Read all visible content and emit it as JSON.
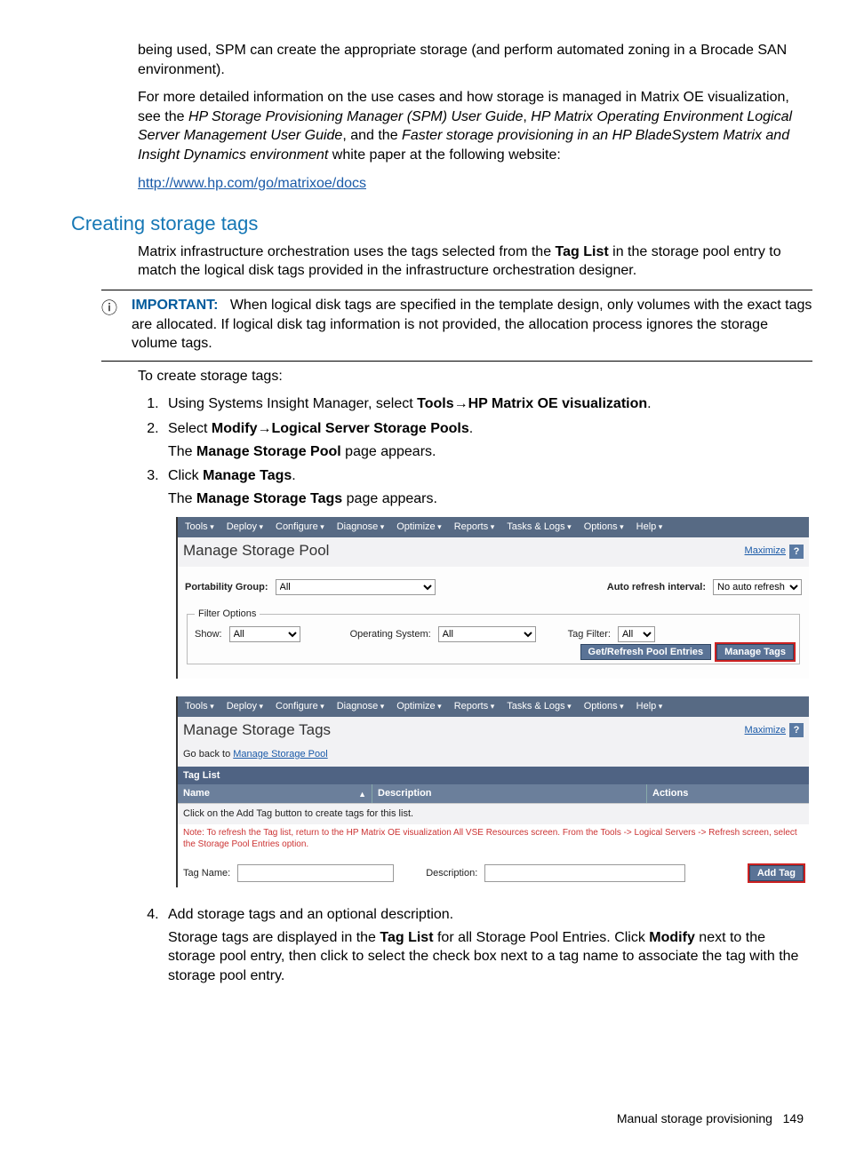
{
  "para1": "being used, SPM can create the appropriate storage (and perform automated zoning in a Brocade SAN environment).",
  "para2a": "For more detailed information on the use cases and how storage is managed in Matrix OE visualization, see the ",
  "para2_em1": "HP Storage Provisioning Manager (SPM) User Guide",
  "para2b": ", ",
  "para2_em2": "HP Matrix Operating Environment Logical Server Management User Guide",
  "para2c": ", and the ",
  "para2_em3": "Faster storage provisioning in an HP BladeSystem Matrix and Insight Dynamics environment",
  "para2d": " white paper at the following website:",
  "doc_link": "http://www.hp.com/go/matrixoe/docs",
  "heading": "Creating storage tags",
  "intro_a": "Matrix infrastructure orchestration uses the tags selected from the ",
  "intro_bold": "Tag List",
  "intro_b": " in the storage pool entry to match the logical disk tags provided in the infrastructure orchestration designer.",
  "important_label": "IMPORTANT:",
  "important_text": "When logical disk tags are specified in the template design, only volumes with the exact tags are allocated. If logical disk tag information is not provided, the allocation process ignores the storage volume tags.",
  "steps_intro": "To create storage tags:",
  "step1_a": "Using Systems Insight Manager, select ",
  "step1_b1": "Tools",
  "step1_arrow": "→",
  "step1_b2": "HP Matrix OE visualization",
  "step1_end": ".",
  "step2_a": "Select ",
  "step2_b1": "Modify",
  "step2_b2": "Logical Server Storage Pools",
  "step2_end": ".",
  "step2_sub_a": "The ",
  "step2_sub_b": "Manage Storage Pool",
  "step2_sub_c": " page appears.",
  "step3_a": "Click ",
  "step3_b": "Manage Tags",
  "step3_end": ".",
  "step3_sub_a": "The ",
  "step3_sub_b": "Manage Storage Tags",
  "step3_sub_c": " page appears.",
  "menubar": [
    "Tools",
    "Deploy",
    "Configure",
    "Diagnose",
    "Optimize",
    "Reports",
    "Tasks & Logs",
    "Options",
    "Help"
  ],
  "shot1": {
    "title": "Manage Storage Pool",
    "maximize": "Maximize",
    "help": "?",
    "portability_label": "Portability Group:",
    "portability_value": "All",
    "auto_refresh_label": "Auto refresh interval:",
    "auto_refresh_value": "No auto refresh",
    "filter_legend": "Filter Options",
    "show_label": "Show:",
    "show_value": "All",
    "os_label": "Operating System:",
    "os_value": "All",
    "tagfilter_label": "Tag Filter:",
    "tagfilter_value": "All",
    "btn_refresh": "Get/Refresh Pool Entries",
    "btn_manage": "Manage Tags"
  },
  "shot2": {
    "title": "Manage Storage Tags",
    "maximize": "Maximize",
    "help": "?",
    "goback_a": "Go back to ",
    "goback_link": "Manage Storage Pool",
    "taglist_header": "Tag List",
    "col_name": "Name",
    "col_desc": "Description",
    "col_actions": "Actions",
    "hint": "Click on the Add Tag button to create tags for this list.",
    "note": "Note: To refresh the Tag list, return to the HP Matrix OE visualization All VSE Resources screen. From the Tools -> Logical Servers -> Refresh screen, select the Storage Pool Entries option.",
    "tagname_label": "Tag Name:",
    "desc_label": "Description:",
    "btn_add": "Add Tag"
  },
  "step4_a": "Add storage tags and an optional description.",
  "step4_sub_a": "Storage tags are displayed in the ",
  "step4_sub_b1": "Tag List",
  "step4_sub_c": " for all Storage Pool Entries. Click ",
  "step4_sub_b2": "Modify",
  "step4_sub_d": " next to the storage pool entry, then click to select the check box next to a tag name to associate the tag with the storage pool entry.",
  "footer_text": "Manual storage provisioning",
  "footer_page": "149"
}
